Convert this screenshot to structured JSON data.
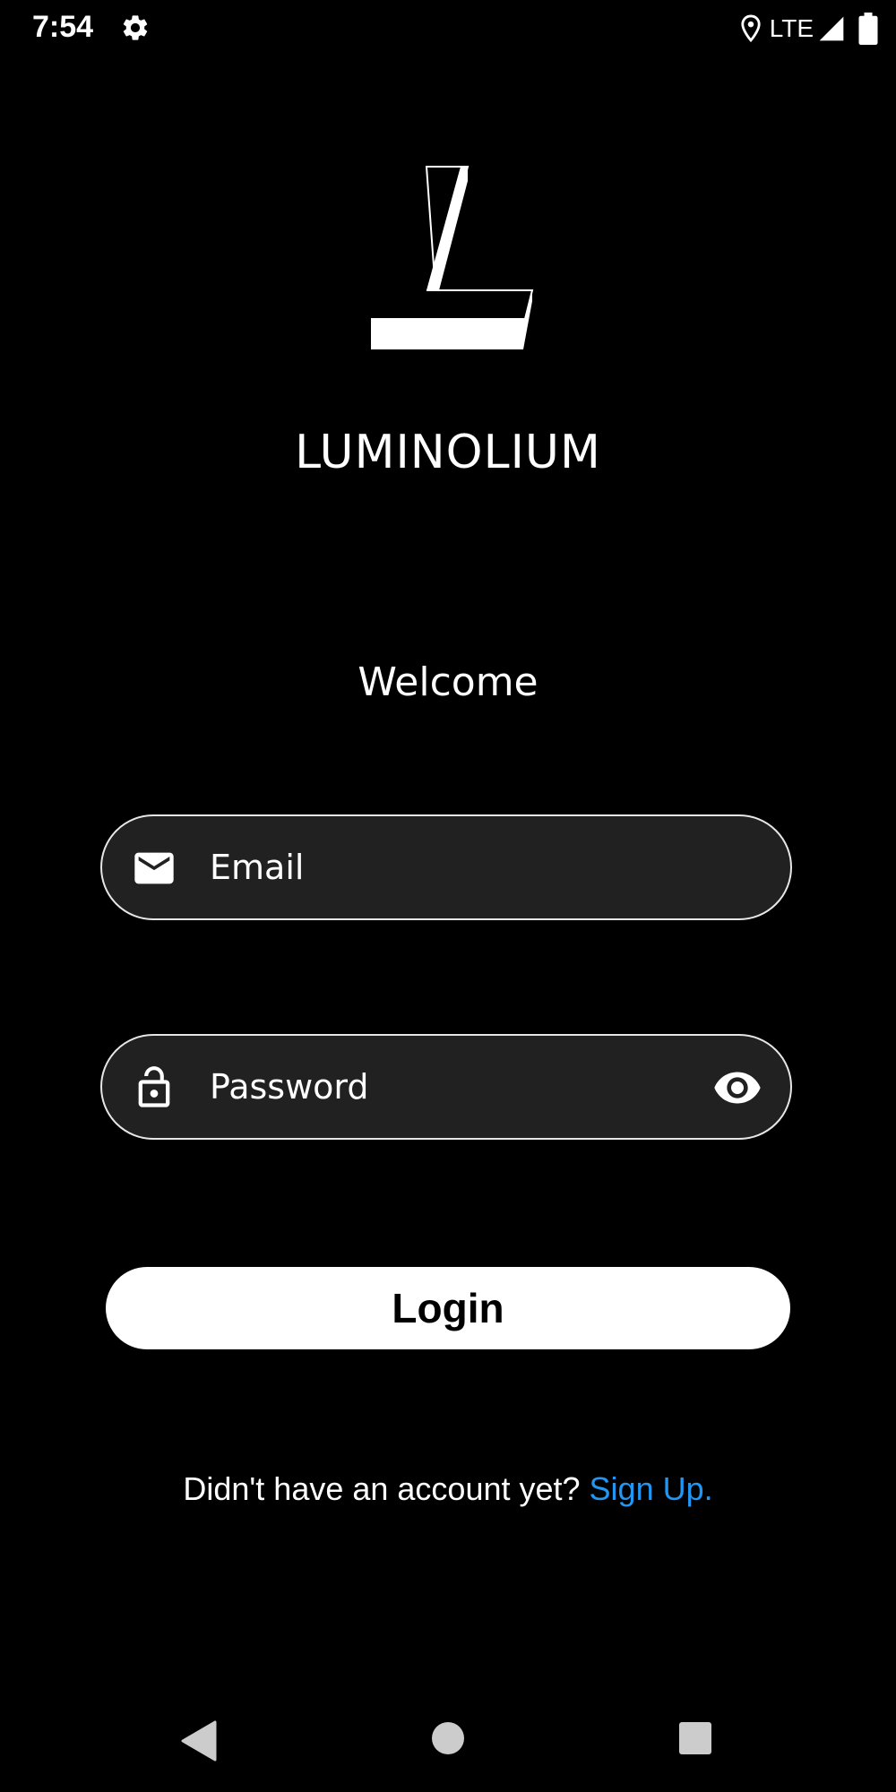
{
  "status_bar": {
    "time": "7:54",
    "network": "LTE",
    "icons": [
      "gear-icon",
      "location-icon",
      "signal-icon",
      "battery-icon"
    ]
  },
  "brand": {
    "logo_icon": "luminolium-logo",
    "name": "LUMINOLIUM"
  },
  "welcome": "Welcome",
  "email_field": {
    "icon": "mail-icon",
    "placeholder": "Email",
    "value": ""
  },
  "password_field": {
    "icon": "lock-icon",
    "placeholder": "Password",
    "value": "",
    "toggle_icon": "eye-icon"
  },
  "login_button": {
    "label": "Login"
  },
  "signup": {
    "prompt": "Didn't have an account yet? ",
    "link": "Sign Up."
  },
  "nav_bar": {
    "icons": [
      "back-icon",
      "home-icon",
      "recents-icon"
    ]
  },
  "colors": {
    "background": "#000000",
    "field_background": "#212121",
    "field_border": "#e6e6e6",
    "link": "#2196f3",
    "button_background": "#ffffff",
    "button_text": "#000000"
  }
}
